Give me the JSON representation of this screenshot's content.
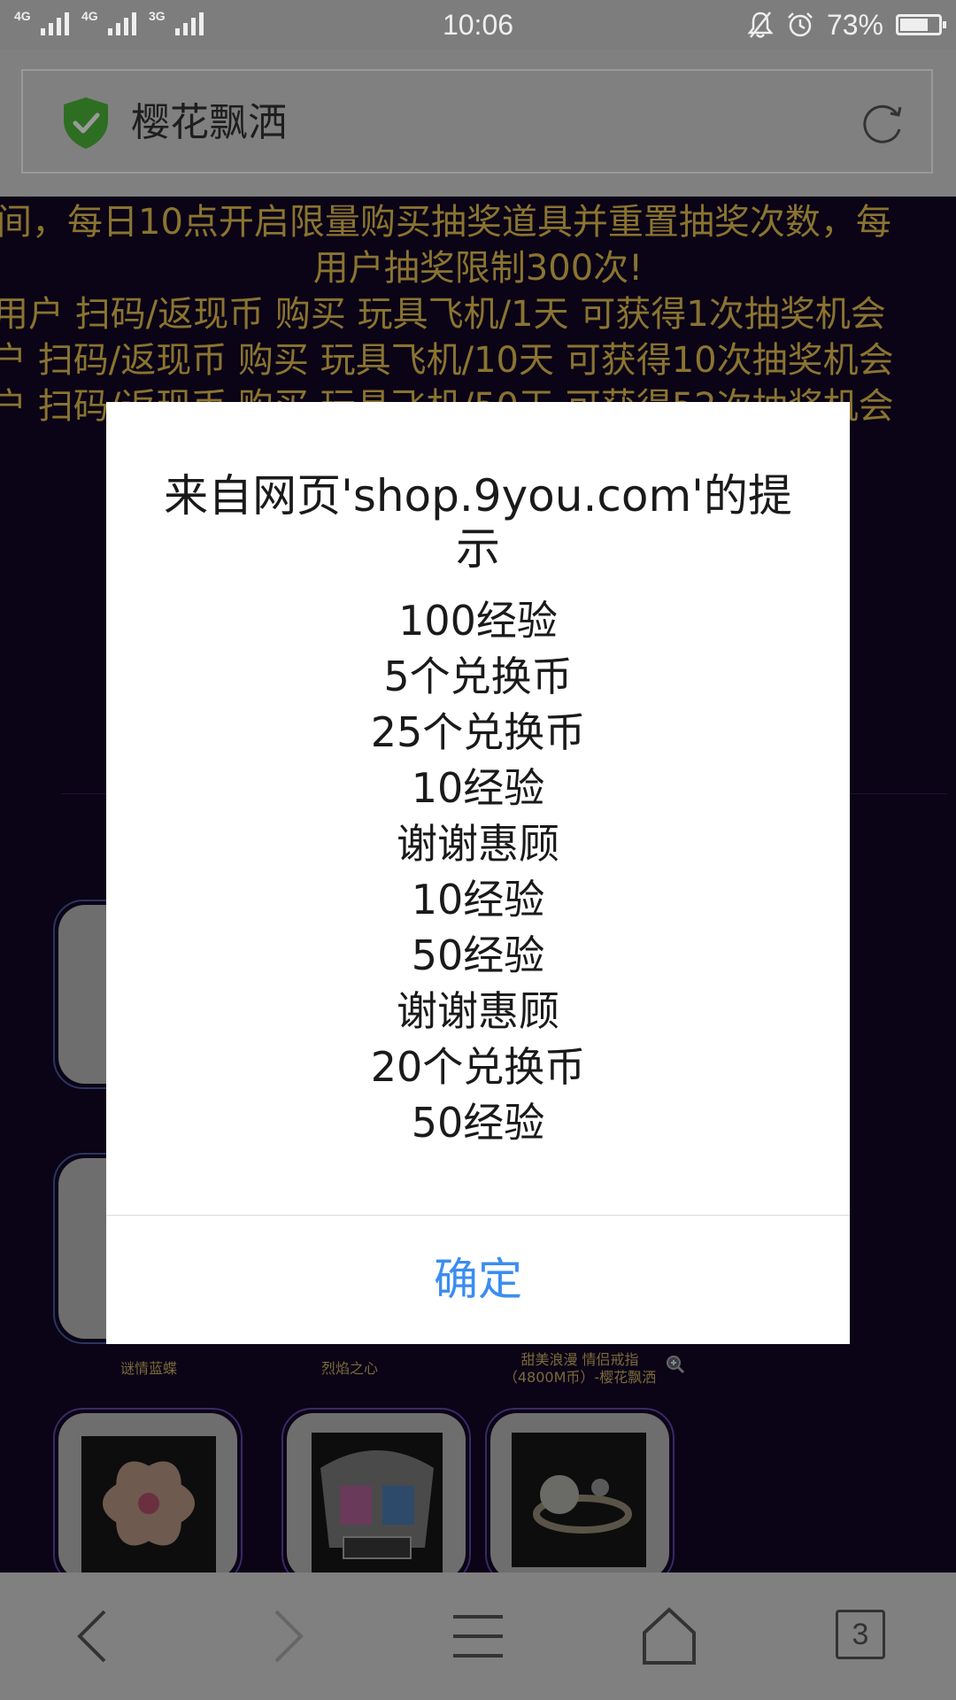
{
  "status_bar": {
    "network_1": "4G",
    "network_2": "4G",
    "network_3": "3G",
    "time": "10:06",
    "battery_percent": "73%",
    "battery_level": 0.73,
    "icons": [
      "bell-off-icon",
      "alarm-icon",
      "battery-icon"
    ]
  },
  "browser": {
    "site_name": "樱花飘洒",
    "security_icon": "shield-check-icon",
    "reload_icon": "reload-icon"
  },
  "page": {
    "notice_lines": [
      "间，每日10点开启限量购买抽奖道具并重置抽奖次数，每",
      "用户抽奖限制300次!",
      "用户 扫码/返现币 购买 玩具飞机/1天 可获得1次抽奖机会",
      "户 扫码/返现币 购买 玩具飞机/10天 可获得10次抽奖机会",
      "户 扫码/返现币 购买 玩具飞机/50天 可获得52次抽奖机会"
    ],
    "items": [
      {
        "name": "谜情蓝蝶"
      },
      {
        "name": "烈焰之心"
      },
      {
        "name": "甜美浪漫 情侣戒指（4800M币）-樱花飘洒",
        "line1": "甜美浪漫 情侣戒指",
        "line2": "（4800M币）-樱花飘洒"
      }
    ]
  },
  "dialog": {
    "title": "来自网页'shop.9you.com'的提示",
    "messages": [
      "100经验",
      "5个兑换币",
      "25个兑换币",
      "10经验",
      "谢谢惠顾",
      "10经验",
      "50经验",
      "谢谢惠顾",
      "20个兑换币",
      "50经验"
    ],
    "confirm_label": "确定",
    "accent_color": "#3b8df0"
  },
  "toolbar": {
    "tab_count": "3",
    "icons": [
      "back-icon",
      "forward-icon",
      "menu-icon",
      "home-icon",
      "tabs-icon"
    ]
  }
}
